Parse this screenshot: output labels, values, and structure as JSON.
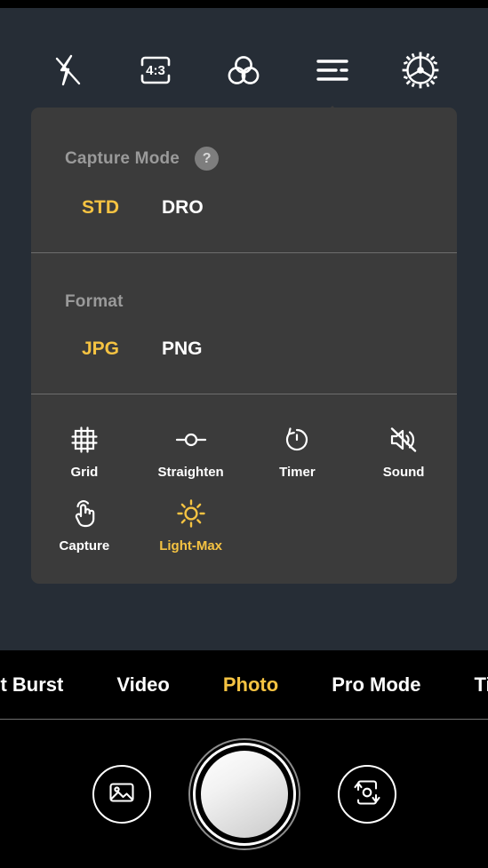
{
  "colors": {
    "accent": "#f5c342",
    "viewfinder_bg": "#262d36",
    "panel_bg": "#3b3b3b",
    "label_gray": "#9a9a9a",
    "white": "#ffffff",
    "black": "#000000",
    "divider": "#6d6d6d",
    "help_badge": "#7e7e7e"
  },
  "toolbar": {
    "items": [
      {
        "name": "flash-off-icon",
        "label": "Flash Off",
        "active": false
      },
      {
        "name": "aspect-ratio-icon",
        "label": "4:3",
        "value": "4:3",
        "active": false
      },
      {
        "name": "color-filter-icon",
        "label": "Color Filter",
        "active": false
      },
      {
        "name": "settings-list-icon",
        "label": "More Settings",
        "active": true
      },
      {
        "name": "gear-icon",
        "label": "Settings",
        "active": false
      }
    ]
  },
  "panel": {
    "capture_mode": {
      "label": "Capture Mode",
      "help": "?",
      "options": [
        {
          "label": "STD",
          "selected": true
        },
        {
          "label": "DRO",
          "selected": false
        }
      ]
    },
    "format": {
      "label": "Format",
      "options": [
        {
          "label": "JPG",
          "selected": true
        },
        {
          "label": "PNG",
          "selected": false
        }
      ]
    },
    "toggles": [
      {
        "label": "Grid",
        "icon": "grid-icon",
        "on": false
      },
      {
        "label": "Straighten",
        "icon": "straighten-icon",
        "on": false
      },
      {
        "label": "Timer",
        "icon": "timer-icon",
        "on": false
      },
      {
        "label": "Sound",
        "icon": "sound-off-icon",
        "on": false
      },
      {
        "label": "Capture",
        "icon": "touch-capture-icon",
        "on": false
      },
      {
        "label": "Light-Max",
        "icon": "sun-icon",
        "on": true
      }
    ]
  },
  "mode_carousel": {
    "modes": [
      {
        "label": "ast Burst",
        "active": false
      },
      {
        "label": "Video",
        "active": false
      },
      {
        "label": "Photo",
        "active": true
      },
      {
        "label": "Pro Mode",
        "active": false
      },
      {
        "label": "Time",
        "active": false
      }
    ]
  },
  "bottom_bar": {
    "gallery": {
      "name": "gallery-icon",
      "label": "Gallery"
    },
    "shutter": {
      "name": "shutter-button",
      "label": "Shutter"
    },
    "switch_camera": {
      "name": "switch-camera-icon",
      "label": "Switch Camera"
    }
  }
}
